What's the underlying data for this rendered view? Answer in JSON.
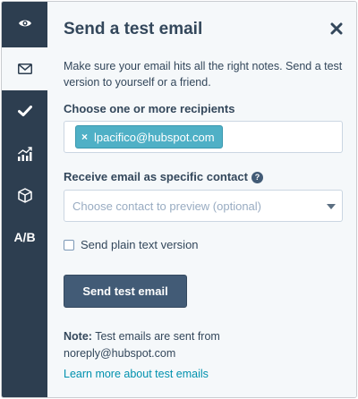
{
  "rail": {
    "items": [
      {
        "icon": "eye-icon",
        "active": false
      },
      {
        "icon": "envelope-icon",
        "active": true
      },
      {
        "icon": "checkmark-icon",
        "active": false
      },
      {
        "icon": "chart-icon",
        "active": false
      },
      {
        "icon": "cube-icon",
        "active": false
      },
      {
        "icon": "ab-test-icon",
        "label": "A/B",
        "active": false
      }
    ]
  },
  "panel": {
    "title": "Send a test email",
    "description": "Make sure your email hits all the right notes. Send a test version to yourself or a friend.",
    "recipients": {
      "label": "Choose one or more recipients",
      "tags": [
        {
          "remove": "×",
          "email": "lpacifico@hubspot.com"
        }
      ]
    },
    "contact": {
      "label": "Receive email as specific contact",
      "help": "?",
      "placeholder": "Choose contact to preview (optional)"
    },
    "plain_text": {
      "label": "Send plain text version",
      "checked": false
    },
    "send_button": "Send test email",
    "note": {
      "prefix": "Note:",
      "line1": " Test emails are sent from",
      "line2": "noreply@hubspot.com"
    },
    "learn_more": "Learn more about test emails"
  },
  "colors": {
    "rail": "#2d3e50",
    "panel": "#f5f8fa",
    "tag": "#4fb0c6",
    "button": "#425b76",
    "link": "#0091ae"
  }
}
